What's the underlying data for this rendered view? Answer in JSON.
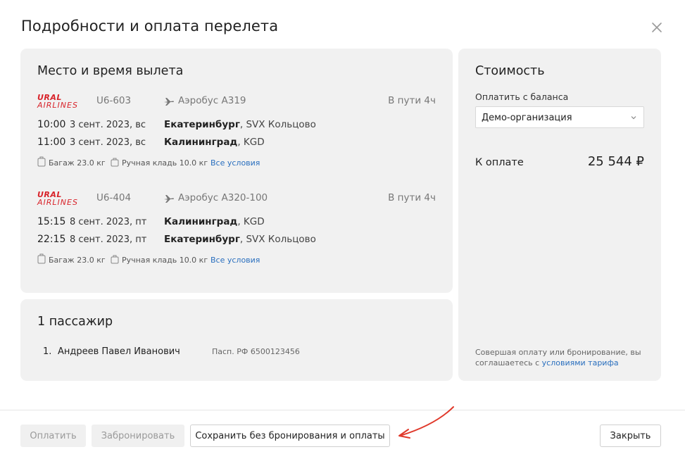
{
  "modal": {
    "title": "Подробности и оплата перелета"
  },
  "flights_section": {
    "heading": "Место и время вылета",
    "flights": [
      {
        "airline_line1": "URAL",
        "airline_line2": "AIRLINES",
        "flight_number": "U6-603",
        "aircraft": "Аэробус А319",
        "duration": "В пути 4ч",
        "departure": {
          "time": "10:00",
          "date": "3 сент. 2023, вс",
          "city": "Екатеринбург",
          "airport": ", SVX Кольцово"
        },
        "arrival": {
          "time": "11:00",
          "date": "3 сент. 2023, вс",
          "city": "Калининград",
          "airport": ", KGD"
        },
        "baggage": "Багаж 23.0 кг",
        "carry_on": "Ручная кладь 10.0 кг",
        "conditions_link": "Все условия"
      },
      {
        "airline_line1": "URAL",
        "airline_line2": "AIRLINES",
        "flight_number": "U6-404",
        "aircraft": "Аэробус А320-100",
        "duration": "В пути 4ч",
        "departure": {
          "time": "15:15",
          "date": "8 сент. 2023, пт",
          "city": "Калининград",
          "airport": ", KGD"
        },
        "arrival": {
          "time": "22:15",
          "date": "8 сент. 2023, пт",
          "city": "Екатеринбург",
          "airport": ", SVX Кольцово"
        },
        "baggage": "Багаж 23.0 кг",
        "carry_on": "Ручная кладь 10.0 кг",
        "conditions_link": "Все условия"
      }
    ]
  },
  "passengers_section": {
    "heading": "1 пассажир",
    "passengers": [
      {
        "number": "1.",
        "name": "Андреев Павел Иванович",
        "document": "Пасп. РФ 6500123456"
      }
    ]
  },
  "cost_section": {
    "heading": "Стоимость",
    "balance_label": "Оплатить с баланса",
    "organization_selected": "Демо-организация",
    "amount_label": "К оплате",
    "amount_value": "25 544 ₽",
    "terms_prefix": "Совершая оплату или бронирование, вы соглашаетесь с ",
    "terms_link": "условиями тарифа"
  },
  "footer": {
    "pay_label": "Оплатить",
    "book_label": "Забронировать",
    "save_label": "Сохранить без бронирования и оплаты",
    "close_label": "Закрыть"
  },
  "colors": {
    "brand_red": "#d8232a",
    "link_blue": "#2a6fbe",
    "panel_bg": "#f1f1f1",
    "annotation_arrow": "#e0392b"
  }
}
